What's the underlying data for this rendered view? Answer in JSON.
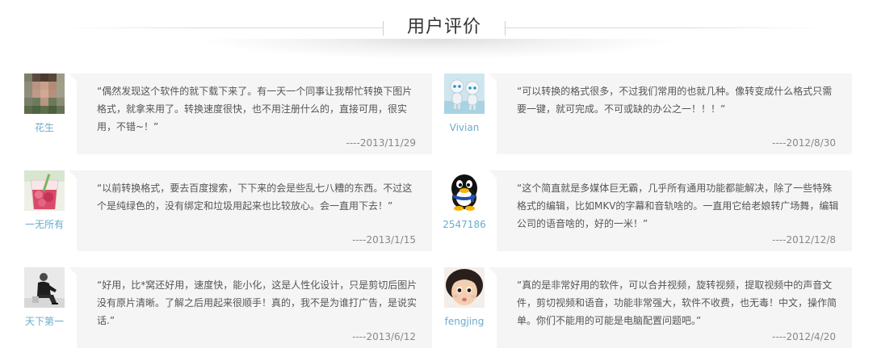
{
  "section": {
    "title": "用户评价"
  },
  "reviews": [
    {
      "name": "花生",
      "avatar_icon": "blurred-face-avatar-icon",
      "quote": "“偶然发现这个软件的就下载下来了。有一天一个同事让我帮忙转换下图片格式，就拿来用了。转换速度很快，也不用注册什么的，直接可用，很实用，不错~！”",
      "date": "----2013/11/29"
    },
    {
      "name": "Vivian",
      "avatar_icon": "robot-pair-avatar-icon",
      "quote": "“可以转换的格式很多，不过我们常用的也就几种。像转变成什么格式只需要一键，就可完成。不可或缺的办公之一！！！”",
      "date": "----2012/8/30"
    },
    {
      "name": "一无所有",
      "avatar_icon": "drink-glass-avatar-icon",
      "quote": "“以前转换格式，要去百度搜索，下下来的会是些乱七八糟的东西。不过这个是纯绿色的，没有绑定和垃圾用起来也比较放心。会一直用下去！”",
      "date": "----2013/1/15"
    },
    {
      "name": "2547186",
      "avatar_icon": "penguin-avatar-icon",
      "quote": "“这个简直就是多媒体巨无霸，几乎所有通用功能都能解决，除了一些特殊格式的编辑，比如MKV的字幕和音轨啥的。一直用它给老娘转广场舞，编辑公司的语音啥的，好的一米！”",
      "date": "----2012/12/8"
    },
    {
      "name": "天下第一",
      "avatar_icon": "person-sitting-avatar-icon",
      "quote": "“好用，比*窝还好用，速度快，能小化，这是人性化设计，只是剪切后图片没有原片清晰。了解之后用起来很顺手！真的，我不是为谁打广告，是说实话.”",
      "date": "----2013/6/12"
    },
    {
      "name": "fengjing",
      "avatar_icon": "child-face-avatar-icon",
      "quote": "“真的是非常好用的软件，可以合并视频，旋转视频，提取视频中的声音文件，剪切视频和语音，功能非常强大，软件不收费，也无毒！中文，操作简单。你们不能用的可能是电脑配置问题吧。”",
      "date": "----2012/4/20"
    }
  ]
}
